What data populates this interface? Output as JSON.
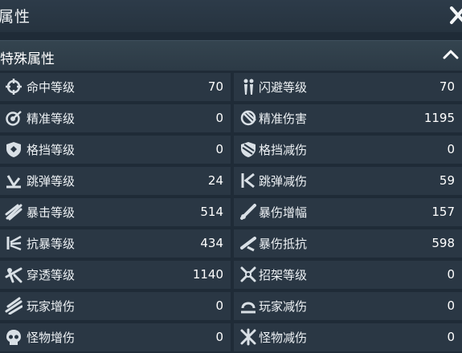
{
  "window": {
    "title": "属性"
  },
  "section": {
    "title": "特殊属性"
  },
  "stats": [
    {
      "left": {
        "icon": "crosshair-icon",
        "label": "命中等级",
        "value": "70"
      },
      "right": {
        "icon": "dodge-figure-icon",
        "label": "闪避等级",
        "value": "70"
      }
    },
    {
      "left": {
        "icon": "precision-target-icon",
        "label": "精准等级",
        "value": "0"
      },
      "right": {
        "icon": "precision-damage-icon",
        "label": "精准伤害",
        "value": "1195"
      }
    },
    {
      "left": {
        "icon": "shield-icon",
        "label": "格挡等级",
        "value": "0"
      },
      "right": {
        "icon": "shield-reduce-icon",
        "label": "格挡减伤",
        "value": "0"
      }
    },
    {
      "left": {
        "icon": "ricochet-icon",
        "label": "跳弹等级",
        "value": "24"
      },
      "right": {
        "icon": "ricochet-reduce-icon",
        "label": "跳弹减伤",
        "value": "59"
      }
    },
    {
      "left": {
        "icon": "critical-claw-icon",
        "label": "暴击等级",
        "value": "514"
      },
      "right": {
        "icon": "critical-damage-icon",
        "label": "暴伤增幅",
        "value": "157"
      }
    },
    {
      "left": {
        "icon": "crit-resist-icon",
        "label": "抗暴等级",
        "value": "434"
      },
      "right": {
        "icon": "crit-damage-resist-icon",
        "label": "暴伤抵抗",
        "value": "598"
      }
    },
    {
      "left": {
        "icon": "penetrate-icon",
        "label": "穿透等级",
        "value": "1140"
      },
      "right": {
        "icon": "parry-icon",
        "label": "招架等级",
        "value": "0"
      }
    },
    {
      "left": {
        "icon": "player-damage-icon",
        "label": "玩家增伤",
        "value": "0"
      },
      "right": {
        "icon": "player-reduce-icon",
        "label": "玩家减伤",
        "value": "0"
      }
    },
    {
      "left": {
        "icon": "skull-icon",
        "label": "怪物增伤",
        "value": "0"
      },
      "right": {
        "icon": "monster-reduce-icon",
        "label": "怪物减伤",
        "value": "0"
      }
    }
  ]
}
